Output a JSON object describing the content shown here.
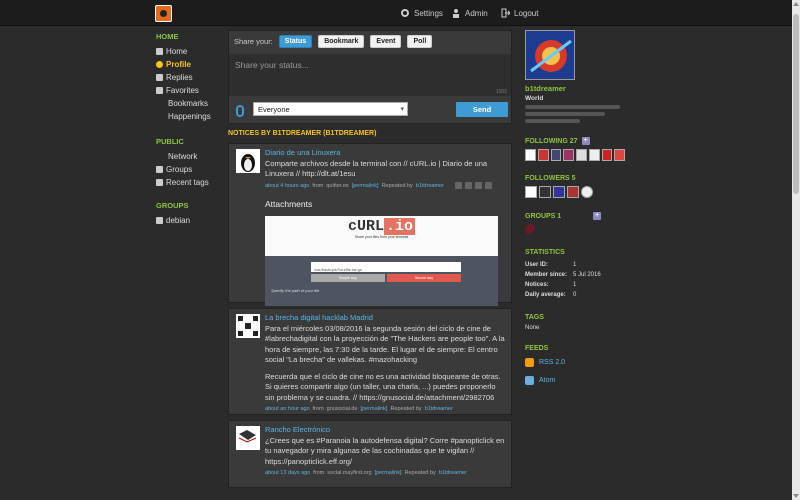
{
  "nav": {
    "settings": "Settings",
    "admin": "Admin",
    "logout": "Logout"
  },
  "left": {
    "home_heading": "HOME",
    "home_items": [
      "Home",
      "Profile",
      "Replies",
      "Favorites"
    ],
    "favorites_sub": [
      "Bookmarks",
      "Happenings"
    ],
    "public_heading": "PUBLIC",
    "public_items": [
      "Network",
      "Groups",
      "Recent tags"
    ],
    "groups_heading": "GROUPS",
    "groups_items": [
      "debian"
    ]
  },
  "share": {
    "label": "Share your:",
    "tabs": [
      "Status",
      "Bookmark",
      "Event",
      "Poll"
    ],
    "placeholder": "Share your status...",
    "counter": "1000",
    "scope": "Everyone",
    "send": "Send"
  },
  "notices_heading": "NOTICES BY B1TDREAMER (B1TDREAMER)",
  "notices": [
    {
      "title": "Diario de una Linuxera",
      "text": "Comparte archivos desde la terminal con // cURL.io | Diario de una Linuxera // http://dlt.at/1esu",
      "time": "about 4 hours ago",
      "from": "from",
      "source": "quitter.es",
      "permalink": "[permalink]",
      "repeated": "Repeated by",
      "repeater": "b1tdreamer",
      "attachments_label": "Attachments"
    },
    {
      "title": "La brecha digital hacklab Madrid",
      "text": "Para el miércoles 03/08/2016 la segunda sesión del ciclo de cine de #labrechadigital con la proyección de \"The Hackers are people too\". A la hora de siempre, las 7:30 de la tarde. El lugar el de siempre: El centro social \"La brecha\" de vallekas. #mazohacking",
      "text2": "Recuerda que el ciclo de cine no es una actividad bloqueante de otras. Si quieres compartir algo (un taller, una charla, ...) puedes proponerlo sin problema y se cuadra. // https://gnusocial.de/attachment/2982706",
      "time": "about an hour ago",
      "from": "from",
      "source": "gnusocial.de",
      "permalink": "[permalink]",
      "repeated": "Repeated by",
      "repeater": "b1tdreamer"
    },
    {
      "title": "Rancho Electrónico",
      "text": "¿Crees que es #Paranoia la autodefensa digital? Corre #panopticlick en tu navegador y mira algunas de las cochinadas que te vigilan // https://panopticlick.eff.org/",
      "time": "about 13 days ago",
      "from": "from",
      "source": "social.mayfirst.org",
      "permalink": "[permalink]",
      "repeated": "Repeated by",
      "repeater": "b1tdreamer"
    }
  ],
  "attachment_preview": {
    "brand_a": "cURL",
    "brand_b": ".io",
    "tagline": "Share your files from your terminal",
    "path": "/var/backups/Yourfile.tar.gz",
    "simple": "Simple way",
    "secure": "Secure way",
    "hint": "Specify the path of your file"
  },
  "profile": {
    "nickname": "b1tdreamer",
    "location": "World",
    "following_heading": "FOLLOWING 27",
    "followers_heading": "FOLLOWERS 5",
    "groups_heading": "GROUPS 1",
    "statistics_heading": "STATISTICS",
    "stats": [
      {
        "k": "User ID:",
        "v": "1"
      },
      {
        "k": "Member since:",
        "v": "5 Jul 2016"
      },
      {
        "k": "Notices:",
        "v": "1"
      },
      {
        "k": "Daily average:",
        "v": "0"
      }
    ],
    "tags_heading": "TAGS",
    "tags_value": "None",
    "feeds_heading": "FEEDS",
    "feeds": [
      "RSS 2.0",
      "Atom"
    ]
  },
  "colors": {
    "accent": "#3e9bd4",
    "green": "#8ec63f",
    "yellow": "#f5c518"
  }
}
